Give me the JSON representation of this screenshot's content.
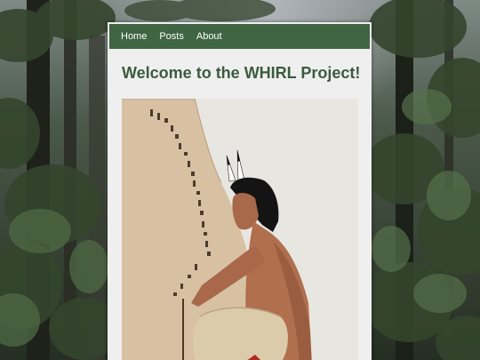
{
  "nav": {
    "items": [
      {
        "label": "Home"
      },
      {
        "label": "Posts"
      },
      {
        "label": "About"
      }
    ]
  },
  "main": {
    "title": "Welcome to the WHIRL Project!"
  },
  "colors": {
    "nav_bg": "#3f6543",
    "heading": "#3b5b41",
    "card_bg": "#efefef"
  }
}
